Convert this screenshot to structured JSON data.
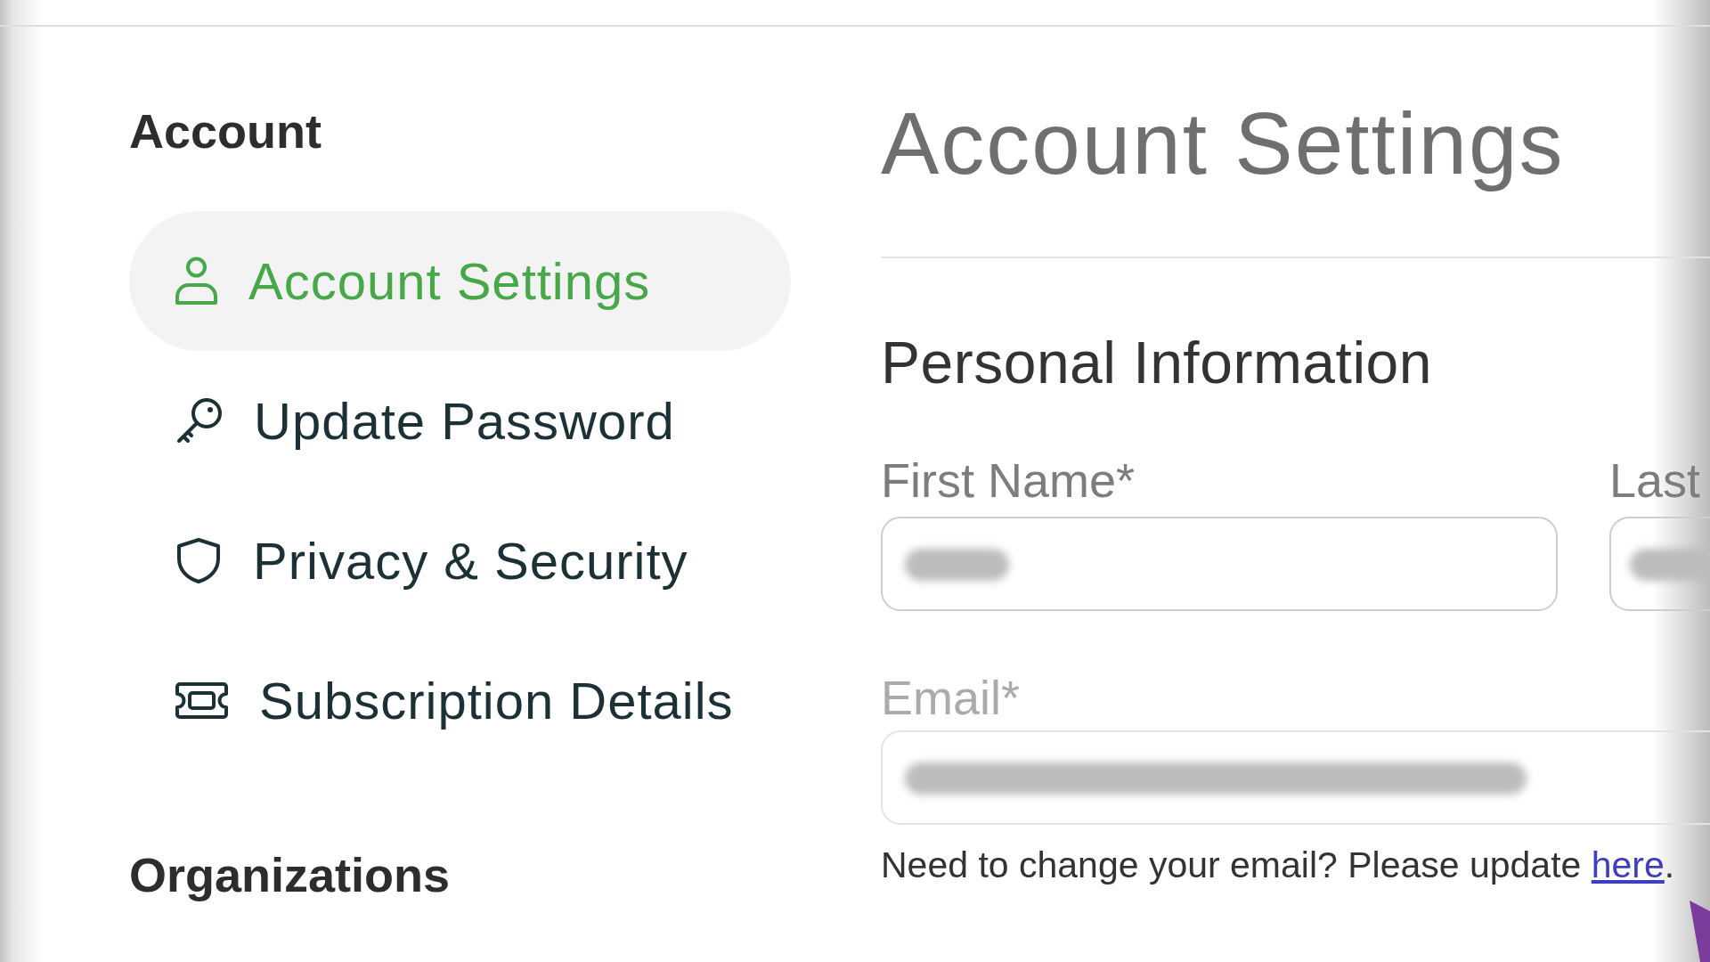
{
  "sidebar": {
    "sections": [
      {
        "heading": "Account",
        "items": [
          {
            "label": "Account Settings",
            "selected": true
          },
          {
            "label": "Update Password",
            "selected": false
          },
          {
            "label": "Privacy & Security",
            "selected": false
          },
          {
            "label": "Subscription Details",
            "selected": false
          }
        ]
      },
      {
        "heading": "Organizations"
      }
    ]
  },
  "page": {
    "title": "Account Settings"
  },
  "personal_information": {
    "heading": "Personal Information",
    "name_fields": [
      {
        "label": "First Name*",
        "redacted": true,
        "disabled": false
      },
      {
        "label": "Last",
        "redacted": true,
        "disabled": false
      }
    ],
    "email": {
      "label": "Email*",
      "redacted": true,
      "disabled": true,
      "help": "Need to change your email? Please update ",
      "help_link": "here",
      "help_end": "."
    }
  }
}
